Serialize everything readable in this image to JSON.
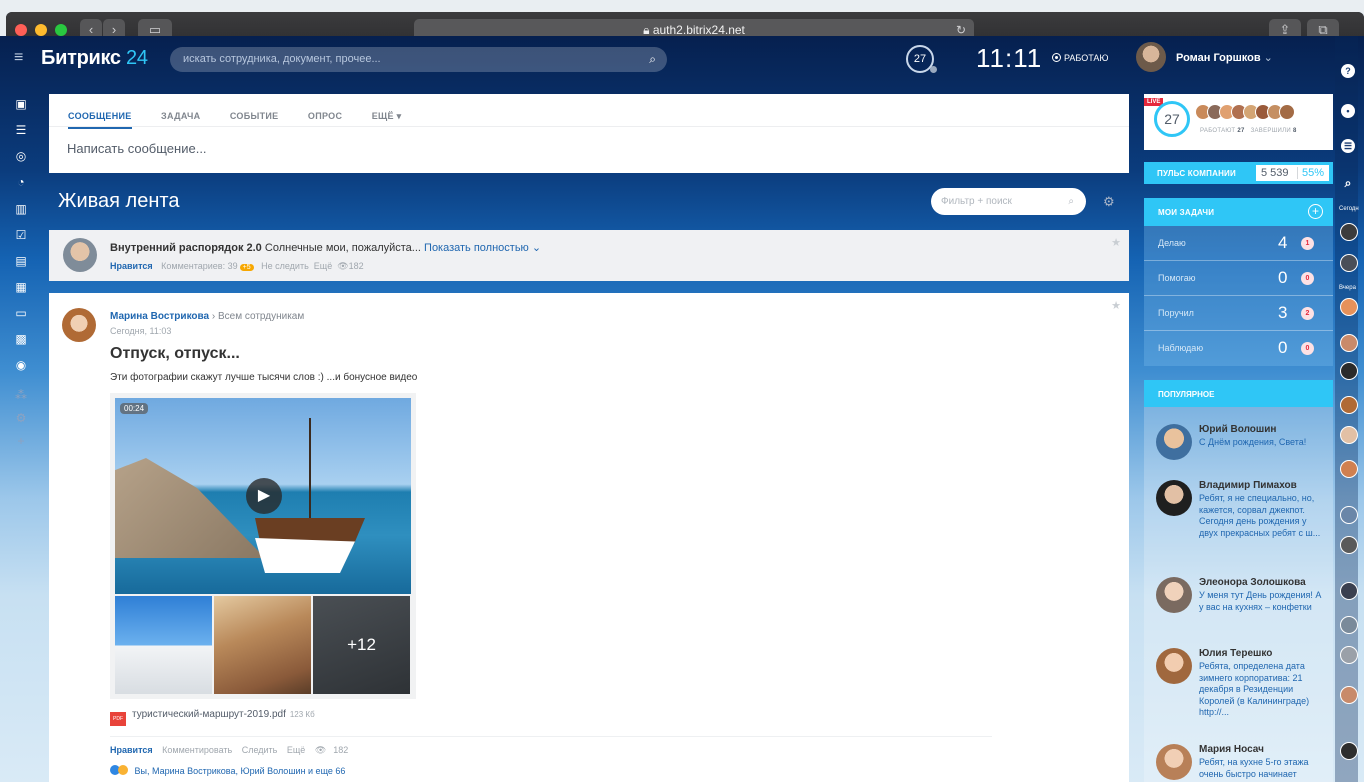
{
  "browser": {
    "url": "auth2.bitrix24.net"
  },
  "header": {
    "logo_main": "Битрикс",
    "logo_num": "24",
    "search_placeholder": "искать сотрудника, документ, прочее...",
    "clock_badge": "27",
    "time": "11:11",
    "work_status": "РАБОТАЮ",
    "user_name": "Роман Горшков"
  },
  "composer": {
    "tabs": [
      "СООБЩЕНИЕ",
      "ЗАДАЧА",
      "СОБЫТИЕ",
      "ОПРОС",
      "ЕЩЁ"
    ],
    "placeholder": "Написать сообщение..."
  },
  "feed": {
    "title": "Живая лента",
    "filter_placeholder": "Фильтр + поиск"
  },
  "pinned": {
    "title": "Внутренний распорядок 2.0",
    "snippet": "Солнечные мои, пожалуйста...",
    "show_more": "Показать полностью",
    "like": "Нравится",
    "comments": "Комментариев: 39",
    "new_badge": "+5",
    "unfollow": "Не следить",
    "more": "Ещё",
    "views": "182"
  },
  "post": {
    "author": "Марина Вострикова",
    "recipient": "Всем сотрдуникам",
    "date": "Сегодня, 11:03",
    "title": "Отпуск, отпуск...",
    "text": "Эти фотографии скажут лучше тысячи слов :) ...и бонусное видео",
    "video_duration": "00:24",
    "more_photos": "+12",
    "file_name": "туристический-маршрут-2019.pdf",
    "file_size": "123 Кб",
    "file_type": "PDF",
    "actions": {
      "like": "Нравится",
      "comment": "Комментировать",
      "follow": "Следить",
      "more": "Ещё",
      "views": "182"
    },
    "likes_text": "Вы, Марина Вострикова, Юрий Волошин и еще 66"
  },
  "right": {
    "live": "LIVE",
    "pulse_count": "27",
    "working_label": "РАБОТАЮТ",
    "working_count": "27",
    "finished_label": "ЗАВЕРШИЛИ",
    "finished_count": "8",
    "pulse_label": "ПУЛЬС КОМПАНИИ",
    "pulse_value": "5 539",
    "pulse_pct": "55%",
    "tasks_label": "МОИ ЗАДАЧИ",
    "tasks": [
      {
        "name": "Делаю",
        "count": "4",
        "badge": "1"
      },
      {
        "name": "Помогаю",
        "count": "0",
        "badge": "0"
      },
      {
        "name": "Поручил",
        "count": "3",
        "badge": "2"
      },
      {
        "name": "Наблюдаю",
        "count": "0",
        "badge": "0"
      }
    ],
    "popular_label": "ПОПУЛЯРНОЕ",
    "popular": [
      {
        "name": "Юрий Волошин",
        "text": "С Днём рождения, Света!"
      },
      {
        "name": "Владимир Пимахов",
        "text": "Ребят, я не специально, но, кажется, сорвал джекпот. Сегодня день рождения у двух прекрасных ребят с ш..."
      },
      {
        "name": "Элеонора Золошкова",
        "text": "У меня тут День рождения! А у вас на кухнях – конфетки"
      },
      {
        "name": "Юлия Терешко",
        "text": "Ребята, определена дата зимнего корпоратива: 21 декабря в Резиденции Королей (в Калининграде) http://..."
      },
      {
        "name": "Мария Носач",
        "text": "Ребят, на кухне 5-го этажа очень быстро начинает"
      }
    ]
  },
  "rstrip": {
    "today": "Сегодн",
    "yesterday": "Вчера"
  },
  "colors": {
    "accent": "#2fc6f6",
    "link": "#2067b0",
    "danger": "#e5283c"
  }
}
